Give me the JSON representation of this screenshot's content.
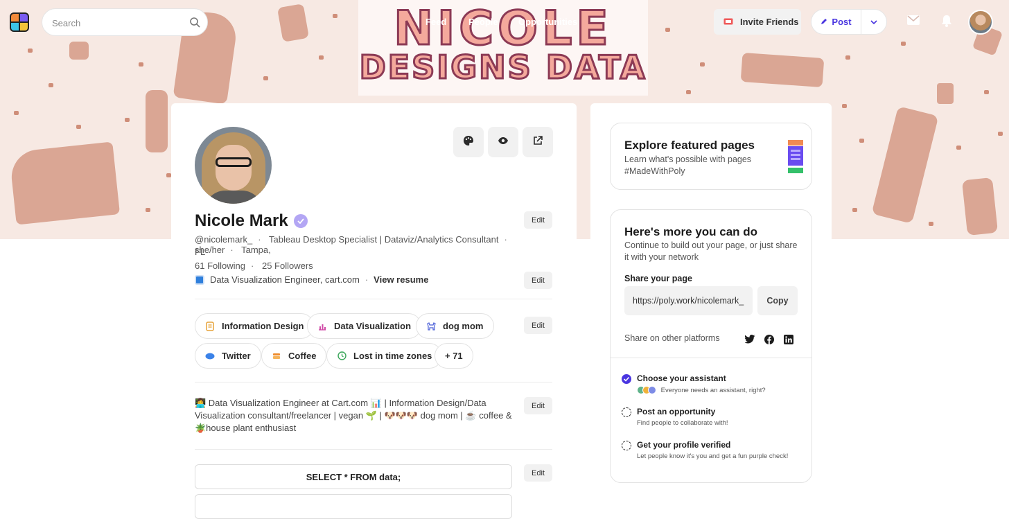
{
  "banner": {
    "title_line1": "NICOLE",
    "title_line2": "DESIGNS DATA"
  },
  "topbar": {
    "search_placeholder": "Search",
    "nav": [
      "Feed",
      "People",
      "Opportunities"
    ],
    "invite_label": "Invite Friends",
    "post_label": "Post"
  },
  "profile": {
    "name": "Nicole Mark",
    "handle": "@nicolemark_",
    "headline": "Tableau Desktop Specialist | Dataviz/Analytics Consultant",
    "pronouns": "she/her",
    "location_a": "Tampa,",
    "location_b": "FL",
    "following": "61 Following",
    "followers": "25 Followers",
    "job": "Data Visualization Engineer, cart.com",
    "resume_link": "View resume",
    "edit_label": "Edit",
    "tags": [
      {
        "label": "Information Design",
        "icon": "☷",
        "color": "#e6a33a"
      },
      {
        "label": "Data Visualization",
        "icon": "▁▃▅",
        "color": "#d04aa7"
      },
      {
        "label": "dog mom",
        "icon": "❀",
        "color": "#4b5fd8"
      },
      {
        "label": "Twitter",
        "icon": "◖",
        "color": "#3b82e8"
      },
      {
        "label": "Coffee",
        "icon": "☕",
        "color": "#ee8b2b"
      },
      {
        "label": "Lost in time zones",
        "icon": "◷",
        "color": "#3aa65a"
      },
      {
        "label": "+ 71",
        "icon": "",
        "color": ""
      }
    ],
    "bio": "👩‍💻 Data Visualization Engineer at Cart.com 📊 | Information Design/Data Visualization consultant/freelancer | vegan 🌱 | 🐶🐶🐶 dog mom | ☕ coffee & 🪴house plant enthusiast",
    "sql_text": "SELECT * FROM data;"
  },
  "sidebar": {
    "featured": {
      "title": "Explore featured pages",
      "desc_a": "Learn what's possible with pages",
      "desc_b": "#MadeWithPoly"
    },
    "more": {
      "title": "Here's more you can do",
      "desc": "Continue to build out your page, or just share it with your network",
      "share_label": "Share your page",
      "url": "https://poly.work/nicolemark_",
      "copy_label": "Copy",
      "other_label": "Share on other platforms"
    },
    "tasks": [
      {
        "title": "Choose your assistant",
        "sub": "Everyone needs an assistant, right?",
        "done": true
      },
      {
        "title": "Post an opportunity",
        "sub": "Find people to collaborate with!",
        "done": false
      },
      {
        "title": "Get your profile verified",
        "sub": "Let people know it's you and get a fun purple check!",
        "done": false
      }
    ]
  },
  "colors": {
    "accent": "#4a36e0",
    "verified": "#b3a6f4",
    "banner_bg": "#f7e9e3",
    "banner_pattern": "#d59a86"
  }
}
